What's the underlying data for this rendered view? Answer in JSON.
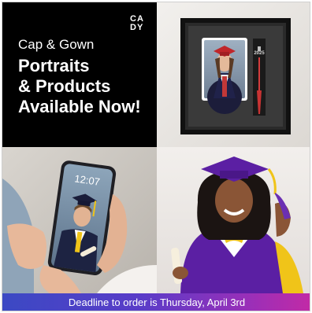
{
  "brand": {
    "logo_line1": "CA",
    "logo_line2": "DY"
  },
  "promo": {
    "eyebrow": "Cap & Gown",
    "headline_lines": [
      "Portraits",
      "& Products",
      "Available Now!"
    ]
  },
  "products": {
    "frame_tassel_year": "2025",
    "phone_time": "12:07"
  },
  "banner": {
    "text": "Deadline to order is Thursday, April 3rd"
  },
  "colors": {
    "headline_bg": "#000000",
    "banner_gradient_start": "#3b49c4",
    "banner_gradient_end": "#c22aa6",
    "gown_purple": "#5b1fa3",
    "gown_gold": "#f0c419"
  }
}
